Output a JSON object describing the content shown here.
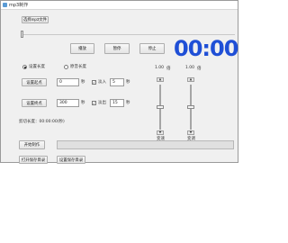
{
  "window": {
    "title": "mp3制作"
  },
  "file": {
    "select_label": "选择mp3文件"
  },
  "playback": {
    "play": "播放",
    "pause": "暂停",
    "stop": "停止"
  },
  "clock": {
    "time": "00:00"
  },
  "mode": {
    "option_cut": "设置长度",
    "option_original": "原音长度",
    "selected": "设置长度"
  },
  "start": {
    "button": "设置起点",
    "value": "0",
    "unit": "秒"
  },
  "fade_in": {
    "checked": true,
    "label": "淡入",
    "value": "5",
    "unit": "秒"
  },
  "end": {
    "button": "设置终点",
    "value": "300",
    "unit": "秒"
  },
  "fade_out": {
    "checked": true,
    "label": "淡出",
    "value": "15",
    "unit": "秒"
  },
  "cut_length": {
    "text": "剪切长度：00:00:00(秒)"
  },
  "speed": {
    "value": "1.00",
    "unit": "倍",
    "caption": "变速",
    "level": 0.5
  },
  "pitch": {
    "value": "1.00",
    "unit": "倍",
    "caption": "变调",
    "level": 0.5
  },
  "actions": {
    "start_make": "开始制作",
    "open_folder": "打开保存目录",
    "set_folder": "设置保存目录"
  },
  "progress": {
    "fraction": 0
  },
  "colors": {
    "clock": "#1f4fd6",
    "window_bg": "#f0f0f0"
  }
}
